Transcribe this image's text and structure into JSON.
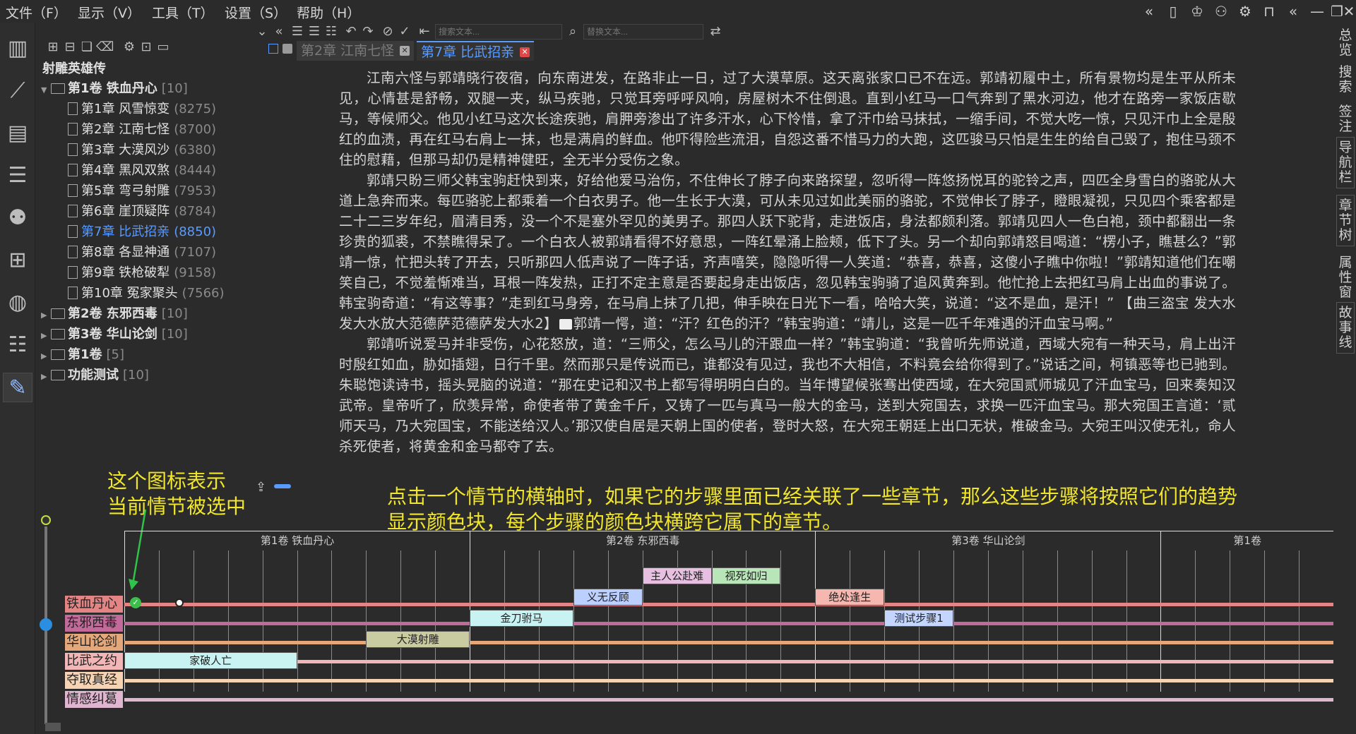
{
  "menu": [
    "文件（F）",
    "显示（V）",
    "工具（T）",
    "设置（S）",
    "帮助（H）"
  ],
  "window_icons": [
    "collapse-left-icon",
    "phone-icon",
    "shirt-icon",
    "user-icon",
    "gear-icon",
    "lock-icon",
    "expand-left-icon",
    "minimize-icon",
    "restore-icon",
    "close-icon"
  ],
  "left_sidebar": [
    "bookshelf-icon",
    "trend-chart-icon",
    "calendar-icon",
    "list-icon",
    "people-icon",
    "grid-icon",
    "globe-icon",
    "tree-list-icon",
    "edit-icon"
  ],
  "right_tabs": [
    "总览",
    "搜索",
    "签注",
    "导航栏",
    "章节树",
    "属性窗",
    "故事线"
  ],
  "tree": {
    "book_title": "射雕英雄传",
    "items": [
      {
        "name": "第1卷 铁血丹心",
        "count": "[10]",
        "type": "folder",
        "expanded": true,
        "bold": true,
        "level": 0
      },
      {
        "name": "第1章 风雪惊变",
        "count": "(8275)",
        "type": "doc",
        "level": 1
      },
      {
        "name": "第2章 江南七怪",
        "count": "(8700)",
        "type": "doc",
        "level": 1
      },
      {
        "name": "第3章 大漠风沙",
        "count": "(6380)",
        "type": "doc",
        "level": 1
      },
      {
        "name": "第4章 黑风双煞",
        "count": "(8444)",
        "type": "doc",
        "level": 1
      },
      {
        "name": "第5章 弯弓射雕",
        "count": "(7953)",
        "type": "doc",
        "level": 1
      },
      {
        "name": "第6章 崖顶疑阵",
        "count": "(8784)",
        "type": "doc",
        "level": 1
      },
      {
        "name": "第7章 比武招亲",
        "count": "(8850)",
        "type": "doc",
        "level": 1,
        "selected": true
      },
      {
        "name": "第8章 各显神通",
        "count": "(7107)",
        "type": "doc",
        "level": 1
      },
      {
        "name": "第9章 铁枪破犁",
        "count": "(9158)",
        "type": "doc",
        "level": 1
      },
      {
        "name": "第10章 冤家聚头",
        "count": "(7566)",
        "type": "doc",
        "level": 1
      },
      {
        "name": "第2卷 东邪西毒",
        "count": "[10]",
        "type": "folder",
        "bold": true,
        "level": 0
      },
      {
        "name": "第3卷 华山论剑",
        "count": "[10]",
        "type": "folder",
        "bold": true,
        "level": 0
      },
      {
        "name": "第1卷",
        "count": "[5]",
        "type": "folder",
        "bold": true,
        "level": 0
      },
      {
        "name": "功能测试",
        "count": "[10]",
        "type": "folder",
        "bold": true,
        "level": 0
      }
    ]
  },
  "editor_toolbar": {
    "search_placeholder": "搜索文本...",
    "replace_placeholder": "替换文本..."
  },
  "tabs": [
    {
      "label": "第2章 江南七怪",
      "active": false
    },
    {
      "label": "第7章 比武招亲",
      "active": true
    }
  ],
  "content": {
    "paragraphs": [
      "江南六怪与郭靖晓行夜宿，向东南进发，在路非止一日，过了大漠草原。这天离张家口已不在远。郭靖初履中土，所有景物均是生平从所未见，心情甚是舒畅，双腿一夹，纵马疾驰，只觉耳旁呼呼风响，房屋树木不住倒退。直到小红马一口气奔到了黑水河边，他才在路旁一家饭店歇马，等候师父。他见小红马这次长途疾驰，肩胛旁渗出了许多汗水，心下怜惜，拿了汗巾给马抹拭，一缩手间，不觉大吃一惊，只见汗巾上全是殷红的血渍，再在红马右肩上一抹，也是满肩的鲜血。他吓得险些流泪，自怨这番不惜马力的大跑，这匹骏马只怕是生生的给自己毁了，抱住马颈不住的慰藉，但那马却仍是精神健旺，全无半分受伤之象。",
      "郭靖只盼三师父韩宝驹赶快到来，好给他爱马治伤，不住伸长了脖子向来路探望，忽听得一阵悠扬悦耳的驼铃之声，四匹全身雪白的骆驼从大道上急奔而来。每匹骆驼上都乘着一个白衣男子。他一生长于大漠，可从未见过如此美丽的骆驼，不觉伸长了脖子，瞪眼凝视，只见四个乘客都是二十二三岁年纪，眉清目秀，没一个不是塞外罕见的美男子。那四人跃下驼背，走进饭店，身法都颇利落。郭靖见四人一色白袍，颈中都翻出一条珍贵的狐裘，不禁瞧得呆了。一个白衣人被郭靖看得不好意思，一阵红晕涌上脸颊，低下了头。另一个却向郭靖怒目喝道：“楞小子，瞧甚么？”郭靖一惊，忙把头转了开去，只听那四人低声说了一阵子话，齐声嘻笑，隐隐听得一人笑道：“恭喜，恭喜，这傻小子瞧中你啦！”郭靖知道他们在嘲笑自己，不觉羞惭难当，耳根一阵发热，正打不定主意是否要起身走出饭店，忽见韩宝驹骑了追风黄奔到。他忙抢上去把红马肩上出血的事说了。韩宝驹奇道：“有这等事？”走到红马身旁，在马肩上抹了几把，伸手映在日光下一看，哈哈大笑，说道：“这不是血，是汗！”",
      "【曲三盗宝 发大水发大水放大范德萨范德萨发大水2】",
      "郭靖一愕，道：“汗？红色的汗？”韩宝驹道：“靖儿，这是一匹千年难遇的汗血宝马啊。”",
      "郭靖听说爱马并非受伤，心花怒放，道：“三师父，怎么马儿的汗跟血一样？”韩宝驹道：“我曾听先师说道，西域大宛有一种天马，肩上出汗时殷红如血，胁如插翅，日行千里。然而那只是传说而已，谁都没有见过，我也不大相信，不料竟会给你得到了。”说话之间，柯镇恶等也已驰到。朱聪饱读诗书，摇头晃脑的说道：“那在史记和汉书上都写得明明白白的。当年博望候张骞出使西域，在大宛国贰师城见了汗血宝马，回来奏知汉武帝。皇帝听了，欣羡异常，命使者带了黄金千斤，又铸了一匹与真马一般大的金马，送到大宛国去，求换一匹汗血宝马。那大宛国王言道：‘贰师天马，乃大宛国宝，不能送给汉人。’那汉使自居是天朝上国的使者，登时大怒，在大宛王朝廷上出口无状，椎破金马。大宛王叫汉使无礼，命人杀死使者，将黄金和金马都夺了去。"
    ]
  },
  "annotations": {
    "left": [
      "这个图标表示",
      "当前情节被选中"
    ],
    "right": [
      "点击一个情节的横轴时，如果它的步骤里面已经关联了一些章节，那么这些步骤将按照它们的趋势",
      "显示颜色块，每个步骤的颜色块横跨它属下的章节。"
    ]
  },
  "timeline": {
    "volumes": [
      "第1卷 铁血丹心",
      "第2卷 东邪西毒",
      "第3卷 华山论剑",
      "第1卷"
    ],
    "lines": [
      {
        "name": "铁血丹心",
        "color": "#e38585"
      },
      {
        "name": "东邪西毒",
        "color": "#c26a9a"
      },
      {
        "name": "华山论剑",
        "color": "#e3a77a"
      },
      {
        "name": "比武之约",
        "color": "#f2b6b6"
      },
      {
        "name": "夺取真经",
        "color": "#f5d3b3"
      },
      {
        "name": "情感纠葛",
        "color": "#e0b5d0"
      }
    ],
    "blocks": [
      {
        "label": "主人公赴难",
        "color": "#e7bfe0"
      },
      {
        "label": "视死如归",
        "color": "#b8e6b8"
      },
      {
        "label": "义无反顾",
        "color": "#bcd0ff"
      },
      {
        "label": "绝处逢生",
        "color": "#f5b7b0"
      },
      {
        "label": "金刀驸马",
        "color": "#c9f3f3"
      },
      {
        "label": "测试步骤1",
        "color": "#c4d6ff"
      },
      {
        "label": "大漠射雕",
        "color": "#c9cca0"
      },
      {
        "label": "家破人亡",
        "color": "#c9f3f3"
      }
    ]
  }
}
